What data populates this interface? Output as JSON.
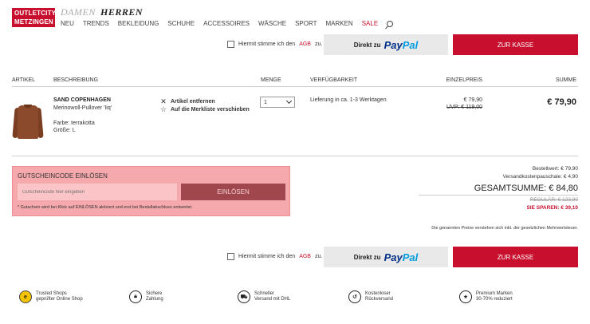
{
  "header": {
    "logo_line1": "OUTLETCITY",
    "logo_line2": "METZINGEN",
    "gender_tabs": [
      "DAMEN",
      "HERREN"
    ],
    "nav": [
      "NEU",
      "TRENDS",
      "BEKLEIDUNG",
      "SCHUHE",
      "ACCESSOIRES",
      "WÄSCHE",
      "SPORT",
      "MARKEN",
      "SALE"
    ],
    "search_icon": "search-icon"
  },
  "checkout": {
    "agb_prefix": "Hiermit stimme ich den",
    "agb_link": "AGB",
    "agb_suffix": "zu.",
    "paypal_prefix": "Direkt zu",
    "paypal_pay": "Pay",
    "paypal_pal": "Pal",
    "kasse_label": "ZUR KASSE"
  },
  "table": {
    "columns": [
      "ARTIKEL",
      "BESCHREIBUNG",
      "MENGE",
      "VERFÜGBARKEIT",
      "EINZELPREIS",
      "SUMME"
    ],
    "rows": [
      {
        "brand": "SAND COPENHAGEN",
        "name": "Merinowoll-Pullover 'Iiq'",
        "farbe": "Farbe: terrakotta",
        "groesse": "Größe: L",
        "remove_label": "Artikel entfernen",
        "wishlist_label": "Auf die Merkliste verschieben",
        "quantity": "1",
        "availability": "Lieferung in ca. 1-3 Werktagen",
        "price": "€ 79,90",
        "uvp": "UVP: € 119,00",
        "sum": "€ 79,90"
      }
    ]
  },
  "voucher": {
    "title": "GUTSCHEINCODE EINLÖSEN",
    "placeholder": "Gutscheincode hier eingeben",
    "button": "EINLÖSEN",
    "note": "* Gutschein wird bei Klick auf EINLÖSEN aktiviert und erst bei Bestellabschluss entwertet."
  },
  "totals": {
    "bestellwert": "Bestellwert: € 79,90",
    "versand": "Versandkostenpauschale: € 4,90",
    "gesamtsumme": "GESAMTSUMME: € 84,80",
    "regular": "REGULÄR: € 123,90",
    "save": "SIE SPAREN: € 39,10",
    "mwst_note": "Die genannten Preise verstehen sich inkl. der gesetzlichen Mehrwertsteuer."
  },
  "features": [
    {
      "icon": "trusted-shops-icon",
      "line1": "Trusted Shops",
      "line2": "geprüfter Online Shop"
    },
    {
      "icon": "lock-icon",
      "line1": "Sichere",
      "line2": "Zahlung"
    },
    {
      "icon": "truck-icon",
      "line1": "Schneller",
      "line2": "Versand mit DHL"
    },
    {
      "icon": "return-icon",
      "line1": "Kostenloser",
      "line2": "Rückversand"
    },
    {
      "icon": "premium-icon",
      "line1": "Premium Marken",
      "line2": "30-70% reduziert"
    }
  ],
  "colors": {
    "brand_red": "#c8102e",
    "voucher_bg": "#f6a9ad",
    "voucher_btn": "#a0474e",
    "paypal_blue": "#003087"
  }
}
